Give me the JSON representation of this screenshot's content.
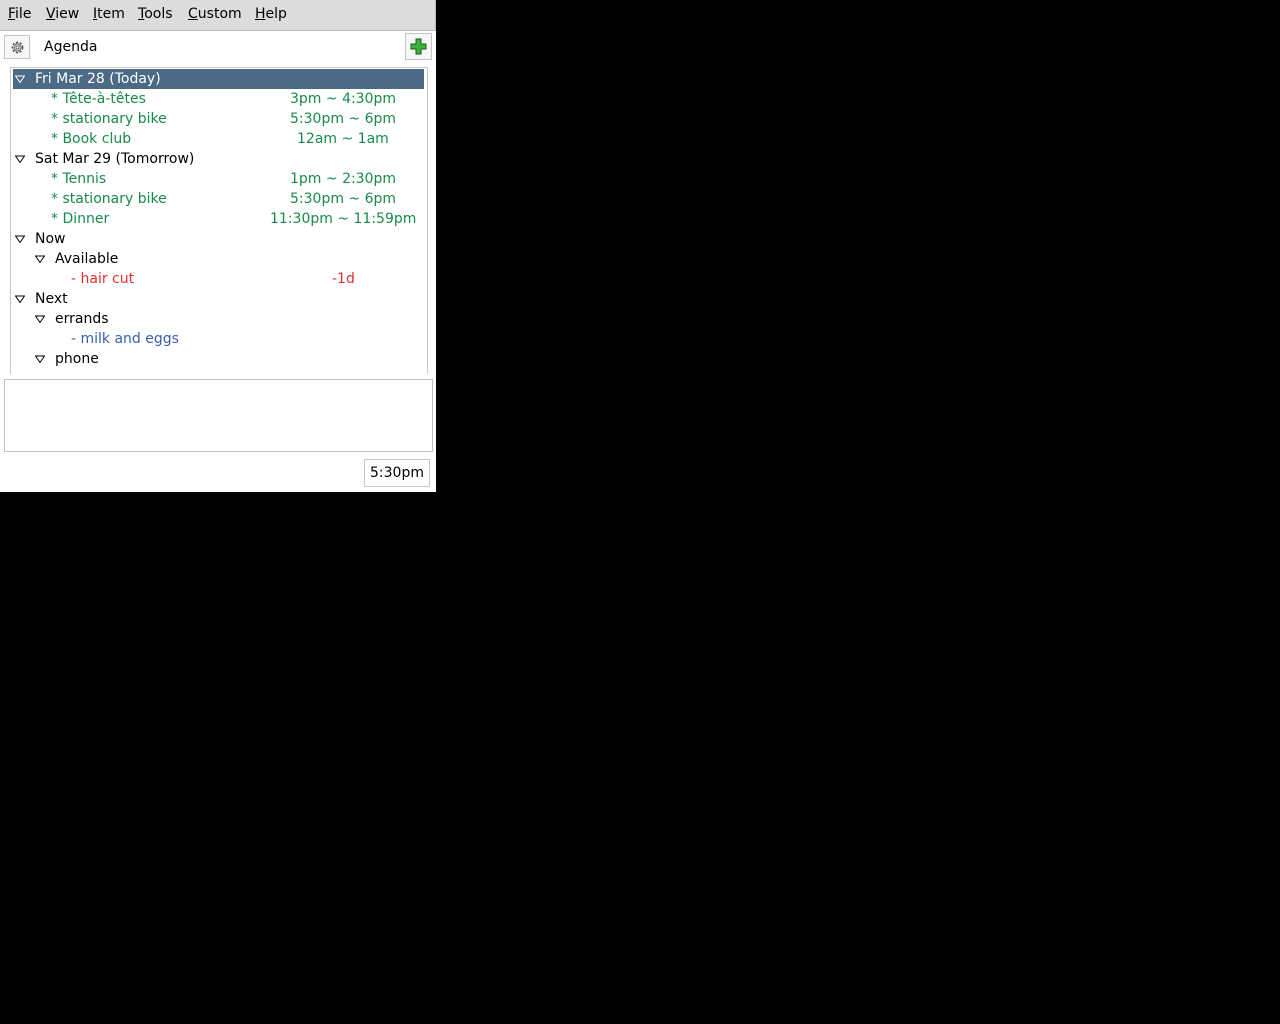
{
  "menubar": {
    "items": [
      {
        "accel": "F",
        "rest": "ile"
      },
      {
        "accel": "V",
        "rest": "iew"
      },
      {
        "accel": "I",
        "rest": "tem"
      },
      {
        "accel": "T",
        "rest": "ools"
      },
      {
        "accel": "C",
        "rest": "ustom"
      },
      {
        "accel": "H",
        "rest": "elp"
      }
    ]
  },
  "toolbar": {
    "view_name": "Agenda",
    "settings_icon": "gear-icon",
    "add_icon": "plus-icon",
    "add_color": "#2aa02a"
  },
  "agenda": {
    "rows": [
      {
        "label": "Fri Mar 28 (Today)"
      },
      {
        "label": "* Tête-à-têtes",
        "time": "3pm ~ 4:30pm"
      },
      {
        "label": "* stationary bike",
        "time": "5:30pm ~ 6pm"
      },
      {
        "label": "* Book club",
        "time": "12am ~ 1am"
      },
      {
        "label": "Sat Mar 29 (Tomorrow)"
      },
      {
        "label": "* Tennis",
        "time": "1pm ~ 2:30pm"
      },
      {
        "label": "* stationary bike",
        "time": "5:30pm ~ 6pm"
      },
      {
        "label": "* Dinner",
        "time": "11:30pm ~ 11:59pm"
      },
      {
        "label": "Now"
      },
      {
        "label": "Available"
      },
      {
        "label": "- hair cut",
        "time": "-1d"
      },
      {
        "label": "Next"
      },
      {
        "label": "errands"
      },
      {
        "label": "- milk and eggs"
      },
      {
        "label": "phone"
      }
    ]
  },
  "colors": {
    "event_green": "#188a4a",
    "overdue_red": "#e03030",
    "task_blue": "#3a5fb0",
    "selection": "#4a6a85"
  },
  "status": {
    "time": "5:30pm"
  }
}
